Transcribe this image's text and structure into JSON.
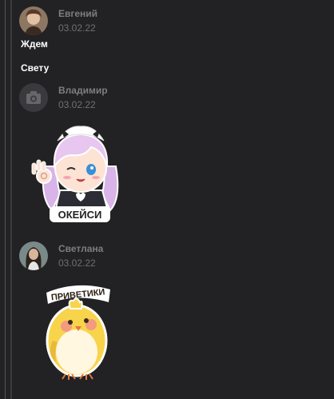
{
  "messages": [
    {
      "author": "Евгений",
      "date": "03.02.22",
      "lines": [
        "Ждем",
        "Свету"
      ],
      "avatar_icon": "user-photo"
    },
    {
      "author": "Владимир",
      "date": "03.02.22",
      "avatar_icon": "camera-icon",
      "sticker": {
        "caption": "ОКЕЙСИ",
        "icon": "anime-girl-ok-sticker"
      }
    },
    {
      "author": "Светлана",
      "date": "03.02.22",
      "avatar_icon": "user-photo",
      "sticker": {
        "caption": "ПРИВЕТИКИ",
        "icon": "yellow-bird-sticker"
      }
    }
  ],
  "colors": {
    "background": "#222225",
    "author": "#7d7d82",
    "date": "#6f6f74",
    "text": "#ffffff"
  }
}
